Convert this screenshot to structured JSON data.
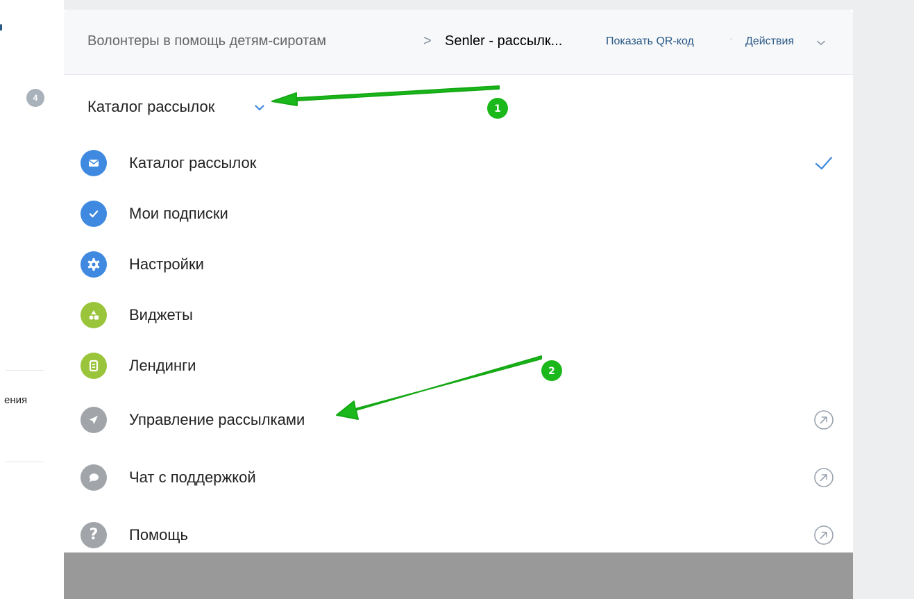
{
  "left_page": {
    "badge_count": "4",
    "cut_text": "ения"
  },
  "header": {
    "group_name": "Волонтеры в помощь детям-сиротам",
    "separator": ">",
    "app_name": "Senler - рассылк...",
    "show_qr_label": "Показать QR-код",
    "separator_dot": "·",
    "actions_label": "Действия"
  },
  "dropdown": {
    "selected": "Каталог рассылок"
  },
  "menu": {
    "items": [
      {
        "label": "Каталог рассылок",
        "icon": "envelope-icon",
        "color": "#3f8ae0",
        "right": "checkmark-icon"
      },
      {
        "label": "Мои подписки",
        "icon": "check-icon",
        "color": "#3f8ae0"
      },
      {
        "label": "Настройки",
        "icon": "gear-icon",
        "color": "#3f8ae0"
      },
      {
        "label": "Виджеты",
        "icon": "widgets-icon",
        "color": "#9ac43a"
      },
      {
        "label": "Лендинги",
        "icon": "landing-icon",
        "color": "#9ac43a"
      },
      {
        "label": "Управление рассылками",
        "icon": "paper-plane-icon",
        "color": "#a1a5aa",
        "right": "external-link-icon"
      },
      {
        "label": "Чат с поддержкой",
        "icon": "chat-bubble-icon",
        "color": "#a1a5aa",
        "right": "external-link-icon"
      },
      {
        "label": "Помощь",
        "icon": "question-icon",
        "color": "#a1a5aa",
        "right": "external-link-icon"
      }
    ]
  },
  "annotations": [
    {
      "number": "1",
      "color": "#1ab81a"
    },
    {
      "number": "2",
      "color": "#1ab81a"
    }
  ]
}
